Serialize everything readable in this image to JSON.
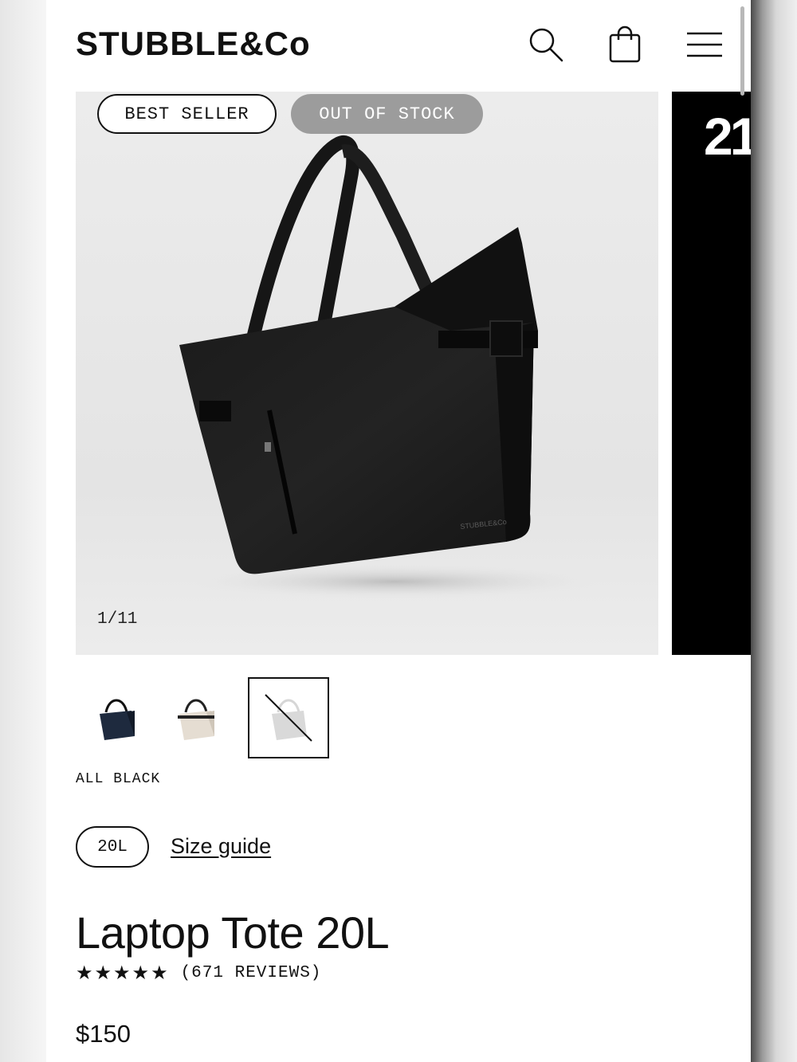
{
  "header": {
    "logo": "STUBBLE&Co",
    "search_icon": "search-icon",
    "cart_icon": "shopping-bag-icon",
    "menu_icon": "hamburger-menu-icon"
  },
  "gallery": {
    "badges": {
      "best_seller": "BEST SELLER",
      "out_of_stock": "OUT OF STOCK"
    },
    "counter": "1/11",
    "next_preview_text": "21",
    "bag_brand_mark": "STUBBLE&Co"
  },
  "variants": {
    "selected_color": "ALL BLACK",
    "thumbnails": [
      "navy",
      "sand",
      "all-black"
    ]
  },
  "size": {
    "selected": "20L",
    "guide_label": "Size guide"
  },
  "product": {
    "title": "Laptop Tote 20L",
    "stars": "★★★★★",
    "rating": 4.8,
    "reviews": "(671 REVIEWS)",
    "price": "$150"
  },
  "colors": {
    "text": "#111111",
    "badge_grey": "#9c9c9c",
    "image_bg": "#e8e8e8"
  }
}
